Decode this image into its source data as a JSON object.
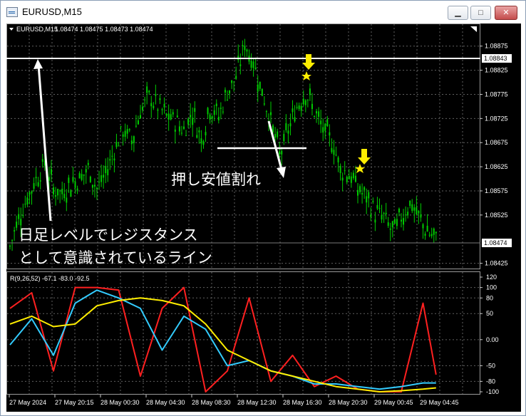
{
  "window": {
    "title": "EURUSD,M15",
    "buttons": [
      "minimize",
      "maximize",
      "close"
    ]
  },
  "chart_header": {
    "symbol": "EURUSD,M15",
    "ohlc": "1.08474 1.08475 1.08473 1.08474",
    "indicator_label": "R(9,26,52) -67.1 -83.0 -92.5"
  },
  "colors": {
    "background": "#000000",
    "candles": "#00cc00",
    "grid": "#606060",
    "rsi_fast": "#ff2020",
    "rsi_mid": "#33ccff",
    "rsi_slow": "#ffee00",
    "annotation_text": "#ffffff",
    "markers": "#ffee00"
  },
  "annotations": {
    "resistance_note_line1": "日足レベルでレジスタンス",
    "resistance_note_line2": "として意識されているライン",
    "pullback_break": "押し安値割れ"
  },
  "price_scale": {
    "labels": [
      "1.08875",
      "1.08825",
      "1.08775",
      "1.08725",
      "1.08675",
      "1.08625",
      "1.08575",
      "1.08525",
      "1.08425"
    ],
    "resistance_level": "1.08843",
    "current_price": "1.08474"
  },
  "indicator_scale": {
    "labels": [
      "120",
      "100",
      "80",
      "50",
      "0.00",
      "-50",
      "-80",
      "-100"
    ]
  },
  "time_axis": {
    "labels": [
      "27 May 2024",
      "27 May 20:15",
      "28 May 00:30",
      "28 May 04:30",
      "28 May 08:30",
      "28 May 12:30",
      "28 May 16:30",
      "28 May 20:30",
      "29 May 00:45",
      "29 May 04:45"
    ]
  },
  "chart_data": [
    {
      "type": "line",
      "title": "EURUSD,M15",
      "series": [
        {
          "name": "EURUSD,M15",
          "x_index": [
            0,
            4,
            8,
            12,
            16,
            20,
            24,
            28,
            32,
            36,
            40,
            44,
            48,
            52,
            56,
            60,
            64,
            68,
            72,
            76,
            80,
            84,
            88,
            92,
            96,
            100,
            104,
            108,
            112,
            116,
            120,
            124,
            128,
            132,
            136,
            140,
            144,
            148,
            152,
            156,
            160,
            164,
            168,
            172,
            176,
            180,
            184,
            188,
            192,
            196
          ],
          "values": [
            1.0846,
            1.0852,
            1.0856,
            1.086,
            1.0863,
            1.0858,
            1.0857,
            1.0859,
            1.086,
            1.0862,
            1.0858,
            1.0861,
            1.0866,
            1.087,
            1.0868,
            1.0874,
            1.0877,
            1.0875,
            1.0873,
            1.0872,
            1.087,
            1.0874,
            1.0868,
            1.0875,
            1.0873,
            1.0878,
            1.0881,
            1.0888,
            1.0884,
            1.0878,
            1.0872,
            1.0865,
            1.087,
            1.0875,
            1.0878,
            1.0874,
            1.087,
            1.0868,
            1.0862,
            1.0861,
            1.0858,
            1.0856,
            1.0853,
            1.0852,
            1.0849,
            1.0852,
            1.0855,
            1.0852,
            1.0849,
            1.08474
          ]
        }
      ],
      "ylim": [
        1.0842,
        1.0891
      ]
    },
    {
      "type": "line",
      "title": "R(9,26,52)",
      "series": [
        {
          "name": "9",
          "x_index": [
            0,
            10,
            20,
            30,
            40,
            50,
            60,
            70,
            80,
            90,
            100,
            110,
            120,
            130,
            140,
            150,
            160,
            170,
            180,
            190,
            196
          ],
          "values": [
            60,
            90,
            -60,
            100,
            100,
            95,
            -70,
            60,
            100,
            -100,
            -60,
            80,
            -80,
            -30,
            -90,
            -70,
            -95,
            -100,
            -100,
            70,
            -67.1
          ]
        },
        {
          "name": "26",
          "x_index": [
            0,
            10,
            20,
            30,
            40,
            50,
            60,
            70,
            80,
            90,
            100,
            110,
            120,
            130,
            140,
            150,
            160,
            170,
            180,
            190,
            196
          ],
          "values": [
            -10,
            40,
            -30,
            70,
            95,
            80,
            60,
            -20,
            45,
            20,
            -50,
            -40,
            -60,
            -70,
            -85,
            -85,
            -90,
            -95,
            -90,
            -83,
            -83.0
          ]
        },
        {
          "name": "52",
          "x_index": [
            0,
            10,
            20,
            30,
            40,
            50,
            60,
            70,
            80,
            90,
            100,
            110,
            120,
            130,
            140,
            150,
            160,
            170,
            180,
            190,
            196
          ],
          "values": [
            30,
            45,
            25,
            30,
            65,
            75,
            80,
            75,
            65,
            30,
            -20,
            -40,
            -60,
            -70,
            -80,
            -90,
            -95,
            -100,
            -98,
            -95,
            -92.5
          ]
        }
      ],
      "ylim": [
        -100,
        120
      ]
    }
  ]
}
